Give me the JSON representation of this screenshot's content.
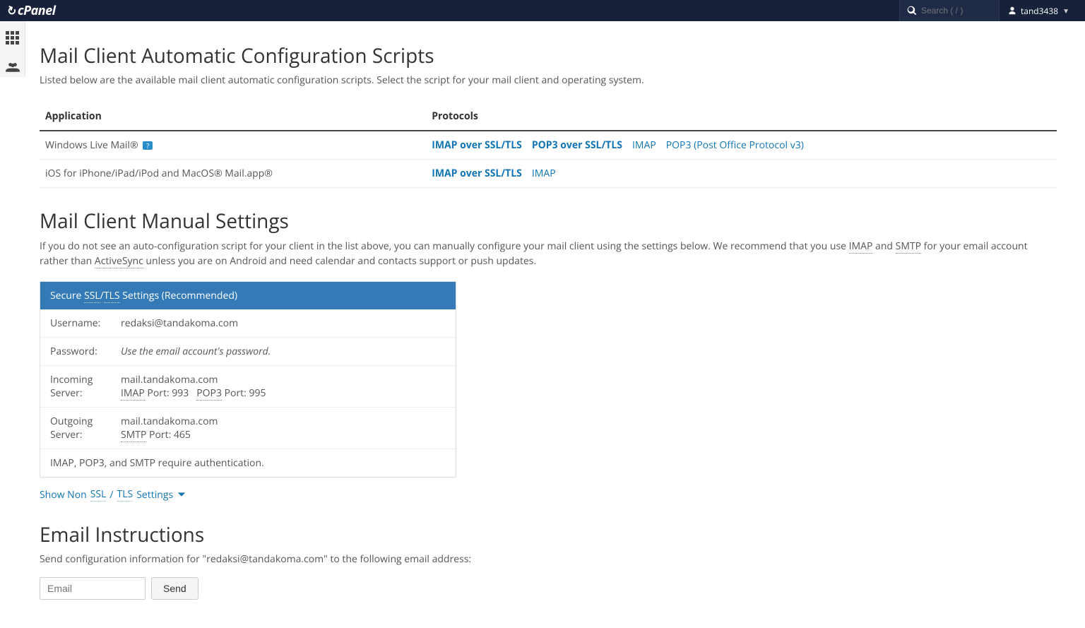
{
  "header": {
    "logo_text": "Panel",
    "search_placeholder": "Search ( / )",
    "username": "tand3438"
  },
  "scripts": {
    "title": "Mail Client Automatic Configuration Scripts",
    "subtitle": "Listed below are the available mail client automatic configuration scripts. Select the script for your mail client and operating system.",
    "col_app": "Application",
    "col_proto": "Protocols",
    "rows": [
      {
        "app": "Windows Live Mail®",
        "help": true,
        "protocols": [
          {
            "label": "IMAP over SSL/TLS",
            "strong": true
          },
          {
            "label": "POP3 over SSL/TLS",
            "strong": true
          },
          {
            "label": "IMAP",
            "strong": false
          },
          {
            "label": "POP3 (Post Office Protocol v3)",
            "strong": false
          }
        ]
      },
      {
        "app": "iOS for iPhone/iPad/iPod and MacOS® Mail.app®",
        "help": false,
        "protocols": [
          {
            "label": "IMAP over SSL/TLS",
            "strong": true
          },
          {
            "label": "IMAP",
            "strong": false
          }
        ]
      }
    ]
  },
  "manual": {
    "title": "Mail Client Manual Settings",
    "desc_pre": "If you do not see an auto-configuration script for your client in the list above, you can manually configure your mail client using the settings below. We recommend that you use ",
    "imap_abbr": "IMAP",
    "and": " and ",
    "smtp_abbr": "SMTP",
    "desc_mid": " for your email account rather than ",
    "activesync_abbr": "ActiveSync",
    "desc_post": " unless you are on Android and need calendar and contacts support or push updates.",
    "card_header_pre": "Secure ",
    "ssl_abbr": "SSL",
    "slash": "/",
    "tls_abbr": "TLS",
    "card_header_post": " Settings (Recommended)",
    "username_label": "Username:",
    "username_value": "redaksi@tandakoma.com",
    "password_label": "Password:",
    "password_value": "Use the email account's password.",
    "incoming_label_1": "Incoming",
    "incoming_label_2": "Server:",
    "incoming_server": "mail.tandakoma.com",
    "imap_port_label": " Port: 993",
    "pop3_abbr": "POP3",
    "pop3_port_label": " Port: 995",
    "outgoing_label_1": "Outgoing",
    "outgoing_label_2": "Server:",
    "outgoing_server": "mail.tandakoma.com",
    "smtp_port_label": " Port: 465",
    "auth_note": "IMAP, POP3, and SMTP require authentication.",
    "show_toggle_pre": "Show Non ",
    "show_toggle_post": " Settings"
  },
  "instructions": {
    "title": "Email Instructions",
    "desc": "Send configuration information for \"redaksi@tandakoma.com\" to the following email address:",
    "placeholder": "Email",
    "send": "Send"
  }
}
